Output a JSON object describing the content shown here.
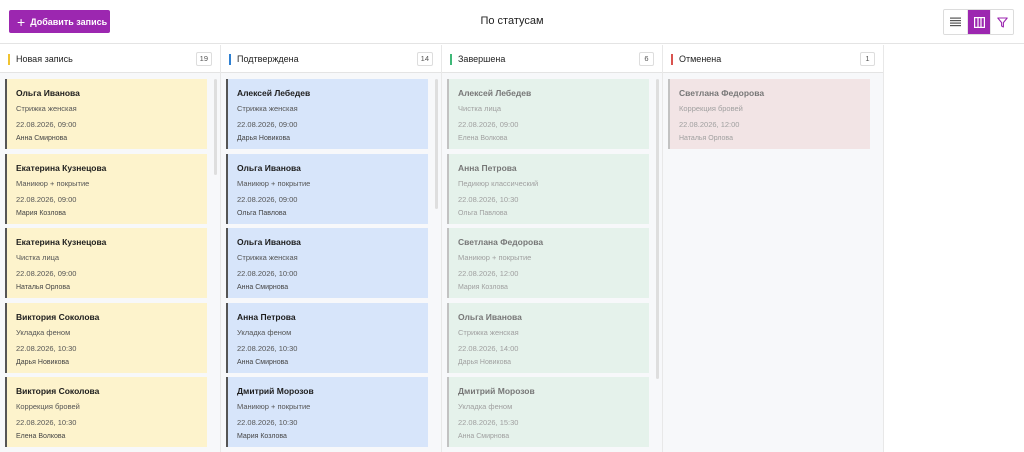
{
  "toolbar": {
    "add_label": "Добавить запись",
    "title": "По статусам"
  },
  "columns": [
    {
      "title": "Новая запись",
      "count": "19",
      "color": "#f0c330",
      "card_bg": "#fdf3cc",
      "cards": [
        {
          "name": "Ольга Иванова",
          "service": "Стрижка женская",
          "time": "22.08.2026, 09:00",
          "master": "Анна Смирнова"
        },
        {
          "name": "Екатерина Кузнецова",
          "service": "Маникюр + покрытие",
          "time": "22.08.2026, 09:00",
          "master": "Мария Козлова"
        },
        {
          "name": "Екатерина Кузнецова",
          "service": "Чистка лица",
          "time": "22.08.2026, 09:00",
          "master": "Наталья Орлова"
        },
        {
          "name": "Виктория Соколова",
          "service": "Укладка феном",
          "time": "22.08.2026, 10:30",
          "master": "Дарья Новикова"
        },
        {
          "name": "Виктория Соколова",
          "service": "Коррекция бровей",
          "time": "22.08.2026, 10:30",
          "master": "Елена Волкова"
        }
      ]
    },
    {
      "title": "Подтверждена",
      "count": "14",
      "color": "#2f80d1",
      "card_bg": "#d7e5fa",
      "cards": [
        {
          "name": "Алексей Лебедев",
          "service": "Стрижка женская",
          "time": "22.08.2026, 09:00",
          "master": "Дарья Новикова"
        },
        {
          "name": "Ольга Иванова",
          "service": "Маникюр + покрытие",
          "time": "22.08.2026, 09:00",
          "master": "Ольга Павлова"
        },
        {
          "name": "Ольга Иванова",
          "service": "Стрижка женская",
          "time": "22.08.2026, 10:00",
          "master": "Анна Смирнова"
        },
        {
          "name": "Анна Петрова",
          "service": "Укладка феном",
          "time": "22.08.2026, 10:30",
          "master": "Анна Смирнова"
        },
        {
          "name": "Дмитрий Морозов",
          "service": "Маникюр + покрытие",
          "time": "22.08.2026, 10:30",
          "master": "Мария Козлова"
        }
      ]
    },
    {
      "title": "Завершена",
      "count": "6",
      "color": "#3fb878",
      "card_bg": "#e5f2eb",
      "cards": [
        {
          "name": "Алексей Лебедев",
          "service": "Чистка лица",
          "time": "22.08.2026, 09:00",
          "master": "Елена Волкова"
        },
        {
          "name": "Анна Петрова",
          "service": "Педикюр классический",
          "time": "22.08.2026, 10:30",
          "master": "Ольга Павлова"
        },
        {
          "name": "Светлана Федорова",
          "service": "Маникюр + покрытие",
          "time": "22.08.2026, 12:00",
          "master": "Мария Козлова"
        },
        {
          "name": "Ольга Иванова",
          "service": "Стрижка женская",
          "time": "22.08.2026, 14:00",
          "master": "Дарья Новикова"
        },
        {
          "name": "Дмитрий Морозов",
          "service": "Укладка феном",
          "time": "22.08.2026, 15:30",
          "master": "Анна Смирнова"
        }
      ]
    },
    {
      "title": "Отменена",
      "count": "1",
      "color": "#d9534f",
      "card_bg": "#f2e4e5",
      "cards": [
        {
          "name": "Светлана Федорова",
          "service": "Коррекция бровей",
          "time": "22.08.2026, 12:00",
          "master": "Наталья Орлова"
        }
      ]
    }
  ],
  "icons": {
    "add": "plus-icon",
    "list_view": "list-view-icon",
    "kanban_view": "kanban-view-icon",
    "filter": "filter-icon"
  },
  "accent_color": "#9c27b0"
}
